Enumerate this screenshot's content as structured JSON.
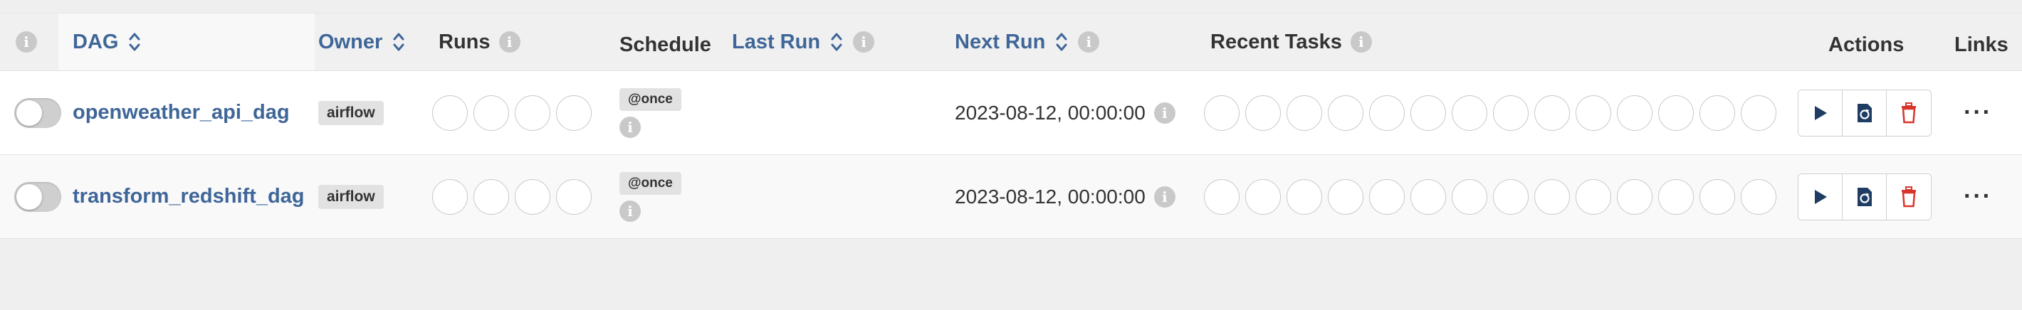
{
  "header": {
    "info_icon": "info-icon",
    "dag": "DAG",
    "owner": "Owner",
    "runs": "Runs",
    "schedule": "Schedule",
    "last_run": "Last Run",
    "next_run": "Next Run",
    "recent_tasks": "Recent Tasks",
    "actions": "Actions",
    "links": "Links",
    "info_glyph": "i"
  },
  "rows": [
    {
      "dag_id": "openweather_api_dag",
      "owner": "airflow",
      "schedule": "@once",
      "last_run": "",
      "next_run": "2023-08-12, 00:00:00",
      "paused": true
    },
    {
      "dag_id": "transform_redshift_dag",
      "owner": "airflow",
      "schedule": "@once",
      "last_run": "",
      "next_run": "2023-08-12, 00:00:00",
      "paused": true
    }
  ],
  "links_menu": "···",
  "colors": {
    "link": "#3f6698",
    "delete": "#d9342b",
    "header_bg": "#f0f0f0"
  }
}
